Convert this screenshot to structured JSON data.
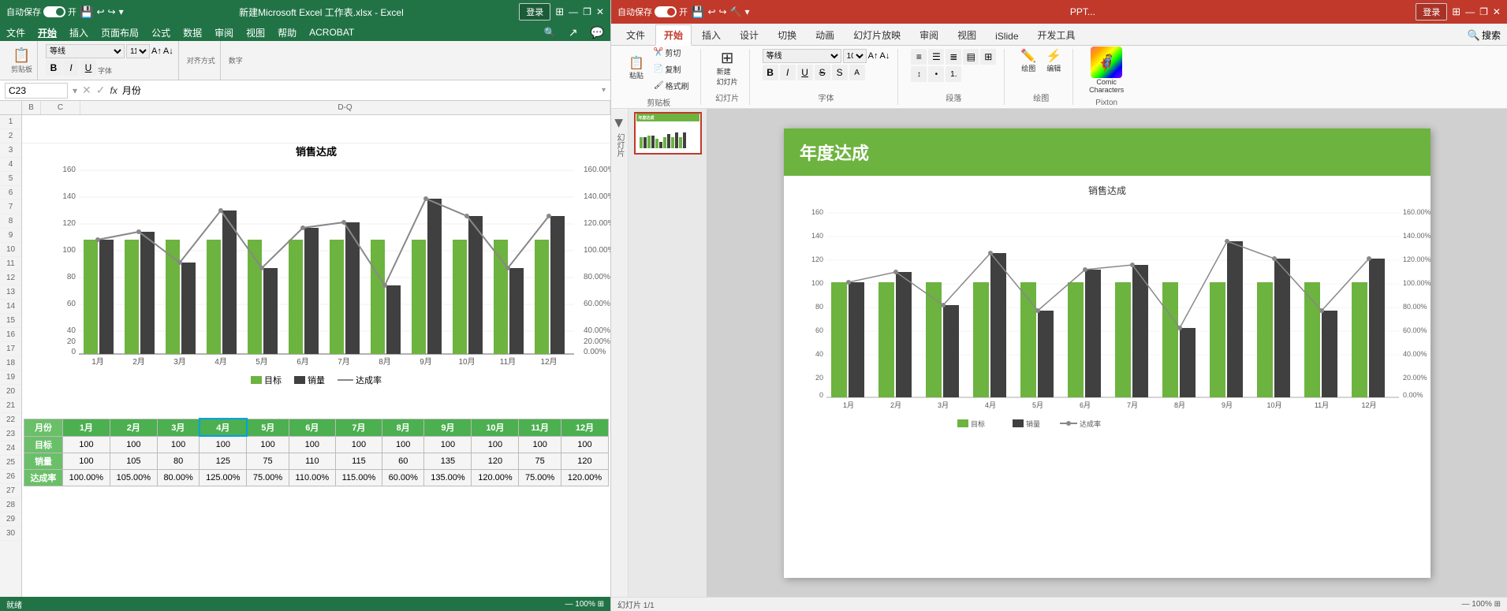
{
  "excel": {
    "titlebar": {
      "autosave": "自动保存",
      "autosave_state": "开",
      "filename": "新建Microsoft Excel 工作表.xlsx - Excel",
      "login": "登录",
      "min": "—",
      "restore": "❐",
      "close": "✕"
    },
    "ribbon_tabs": [
      "文件",
      "开始",
      "插入",
      "页面布局",
      "公式",
      "数据",
      "审阅",
      "视图",
      "帮助",
      "ACROBAT"
    ],
    "search_placeholder": "搜索",
    "formula_bar": {
      "cell_ref": "C23",
      "formula": "月份"
    },
    "chart": {
      "title": "销售达成",
      "months": [
        "1月",
        "2月",
        "3月",
        "4月",
        "5月",
        "6月",
        "7月",
        "8月",
        "9月",
        "10月",
        "11月",
        "12月"
      ],
      "target": [
        100,
        100,
        100,
        100,
        100,
        100,
        100,
        100,
        100,
        100,
        100,
        100
      ],
      "sales": [
        100,
        105,
        80,
        125,
        75,
        110,
        115,
        60,
        135,
        120,
        75,
        120
      ],
      "rate": [
        100,
        105,
        80,
        125,
        75,
        110,
        115,
        60,
        135,
        120,
        75,
        120
      ],
      "legend": {
        "target": "目标",
        "sales": "销量",
        "rate": "达成率"
      }
    },
    "table": {
      "headers": [
        "月份",
        "1月",
        "2月",
        "3月",
        "4月",
        "5月",
        "6月",
        "7月",
        "8月",
        "9月",
        "10月",
        "11月",
        "12月"
      ],
      "rows": [
        {
          "label": "目标",
          "values": [
            "100",
            "100",
            "100",
            "100",
            "100",
            "100",
            "100",
            "100",
            "100",
            "100",
            "100",
            "100"
          ]
        },
        {
          "label": "销量",
          "values": [
            "100",
            "105",
            "80",
            "125",
            "75",
            "110",
            "115",
            "60",
            "135",
            "120",
            "75",
            "120"
          ]
        },
        {
          "label": "达成率",
          "values": [
            "100.00%",
            "105.00%",
            "80.00%",
            "125.00%",
            "75.00%",
            "110.00%",
            "115.00%",
            "60.00%",
            "135.00%",
            "120.00%",
            "75.00%",
            "120.00%"
          ]
        }
      ]
    }
  },
  "ppt": {
    "titlebar": {
      "autosave": "自动保存",
      "autosave_state": "开",
      "filename": "PPT...",
      "login": "登录",
      "min": "—",
      "restore": "❐",
      "close": "✕"
    },
    "ribbon_tabs": [
      "文件",
      "开始",
      "插入",
      "设计",
      "切换",
      "动画",
      "幻灯片放映",
      "审阅",
      "视图",
      "iSlide",
      "开发工具"
    ],
    "search_placeholder": "搜索",
    "toolbar_groups": [
      {
        "name": "剪贴板",
        "items": [
          "粘贴",
          "剪切",
          "复制",
          "格式刷"
        ]
      },
      {
        "name": "幻灯片",
        "items": [
          "新建幻灯片"
        ]
      },
      {
        "name": "字体",
        "items": []
      },
      {
        "name": "段落",
        "items": []
      },
      {
        "name": "Pixton",
        "items": [
          "绘图",
          "编辑",
          "Comic Characters"
        ]
      }
    ],
    "slide": {
      "header_title": "年度达成",
      "chart_title": "销售达成",
      "months": [
        "1月",
        "2月",
        "3月",
        "4月",
        "5月",
        "6月",
        "7月",
        "8月",
        "9月",
        "10月",
        "11月",
        "12月"
      ],
      "target": [
        100,
        100,
        100,
        100,
        100,
        100,
        100,
        100,
        100,
        100,
        100,
        100
      ],
      "sales": [
        100,
        105,
        80,
        125,
        75,
        110,
        115,
        60,
        135,
        120,
        75,
        120
      ],
      "rate": [
        100,
        105,
        80,
        125,
        75,
        110,
        115,
        60,
        135,
        120,
        75,
        120
      ],
      "legend": {
        "target": "目标",
        "sales": "销量",
        "rate": "达成率"
      }
    },
    "sidebar_label": "幻灯片"
  },
  "colors": {
    "excel_green": "#217346",
    "ppt_red": "#c0392b",
    "chart_green": "#6db33f",
    "chart_dark": "#404040",
    "chart_line": "#888888",
    "header_green": "#6db33f",
    "table_header_bg": "#4caf50",
    "table_first_col": "#6abf69"
  }
}
